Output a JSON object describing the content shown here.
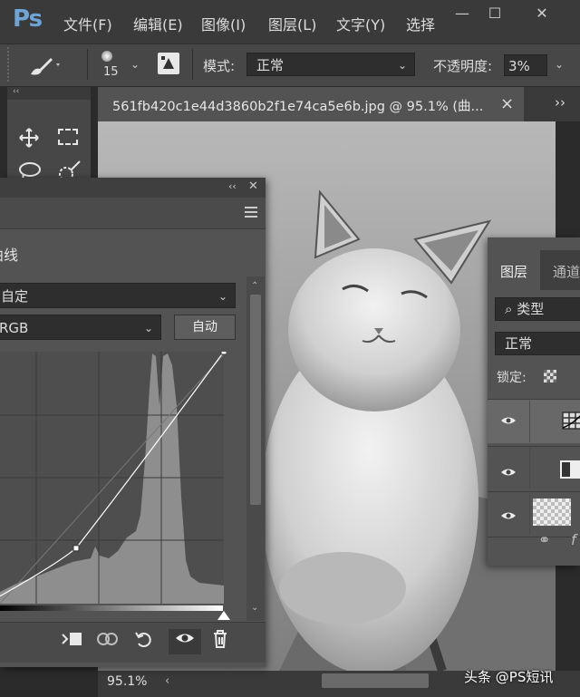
{
  "app": {
    "logo": "Ps",
    "menu": [
      "文件(F)",
      "编辑(E)",
      "图像(I)",
      "图层(L)",
      "文字(Y)",
      "选择"
    ],
    "window_controls": {
      "minimize": "—",
      "restore": "☐",
      "close": "✕"
    }
  },
  "options_bar": {
    "brush_size": "15",
    "mode_label": "模式:",
    "mode_value": "正常",
    "opacity_label": "不透明度:",
    "opacity_value": "3%"
  },
  "tools_panel": {
    "collapse": "‹‹",
    "tools": [
      "move-icon",
      "marquee-icon",
      "lasso-icon",
      "quick-select-icon"
    ]
  },
  "document": {
    "tab_title": "561fb420c1e44d3860b2f1e74ca5e6b.jpg @ 95.1% (曲...",
    "tab_close": "×",
    "zoom": "95.1%",
    "watermark": "头条 @PS短讯"
  },
  "curves_panel": {
    "collapse": "‹‹",
    "close": "✕",
    "title": "曲线",
    "preset": "自定",
    "channel": "RGB",
    "auto_button": "自动",
    "curve_points": [
      [
        0,
        0.03
      ],
      [
        0.34,
        0.22
      ],
      [
        1.0,
        1.0
      ]
    ],
    "footer_icons": [
      "clip-to-layer-icon",
      "view-previous-icon",
      "reset-icon",
      "visibility-icon",
      "delete-icon"
    ]
  },
  "layers_panel": {
    "tabs": [
      "图层",
      "通道"
    ],
    "filter_label": "类型",
    "blend_mode": "正常",
    "lock_label": "锁定:",
    "layers": [
      {
        "type": "curves-adjustment"
      },
      {
        "type": "mask"
      },
      {
        "type": "image"
      }
    ]
  }
}
